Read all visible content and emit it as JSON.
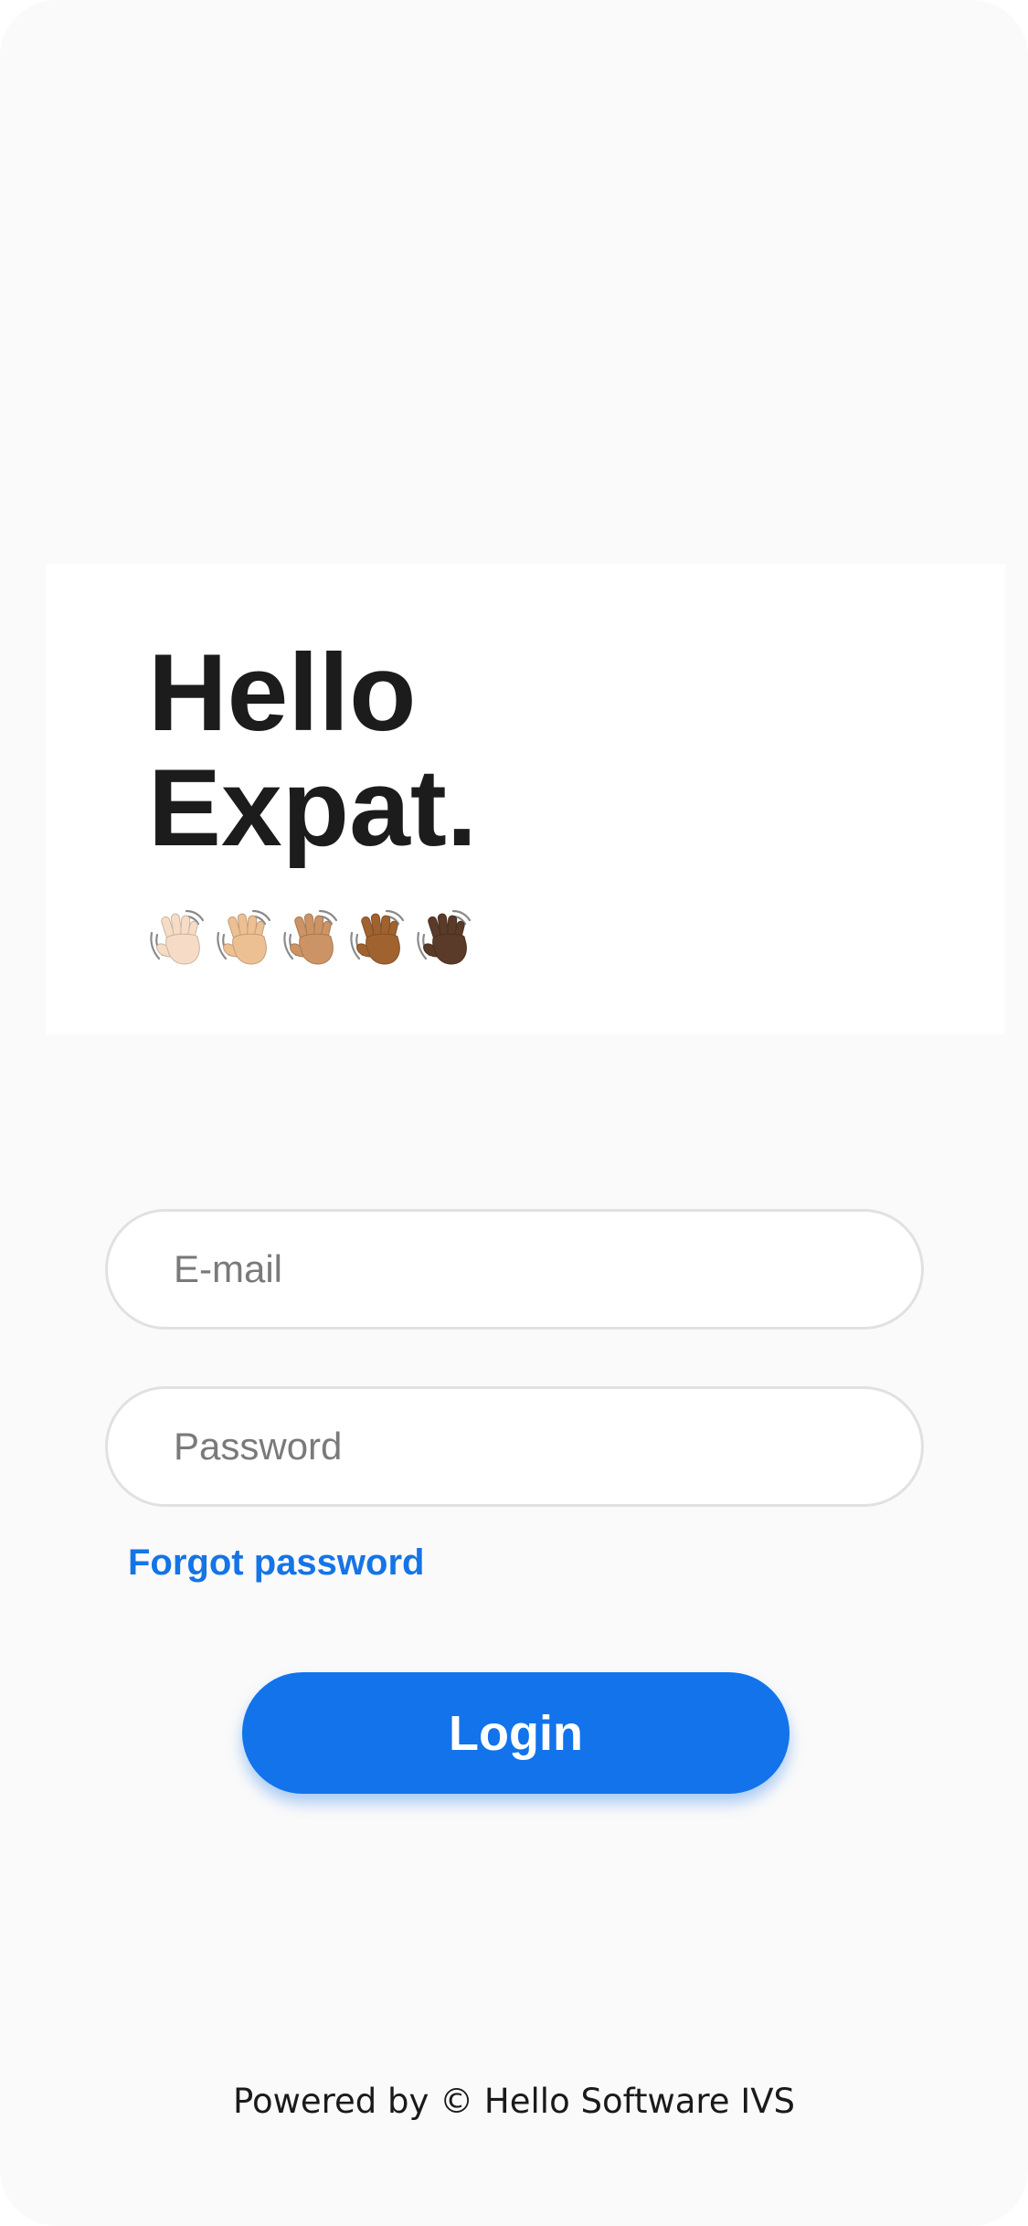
{
  "hero": {
    "title_line1": "Hello",
    "title_line2": "Expat.",
    "wave_emoji_count": 5,
    "wave_skin_tones": [
      "#f6dcc6",
      "#ecc093",
      "#cc9466",
      "#a0622f",
      "#5a3a28"
    ]
  },
  "login_form": {
    "email_placeholder": "E-mail",
    "password_placeholder": "Password",
    "forgot_password_label": "Forgot password",
    "login_button_label": "Login"
  },
  "footer": {
    "text": "Powered by © Hello Software IVS"
  },
  "colors": {
    "accent": "#1273eb",
    "link": "#1574e6",
    "background": "#fafafa",
    "headline": "#1c1c1c"
  }
}
